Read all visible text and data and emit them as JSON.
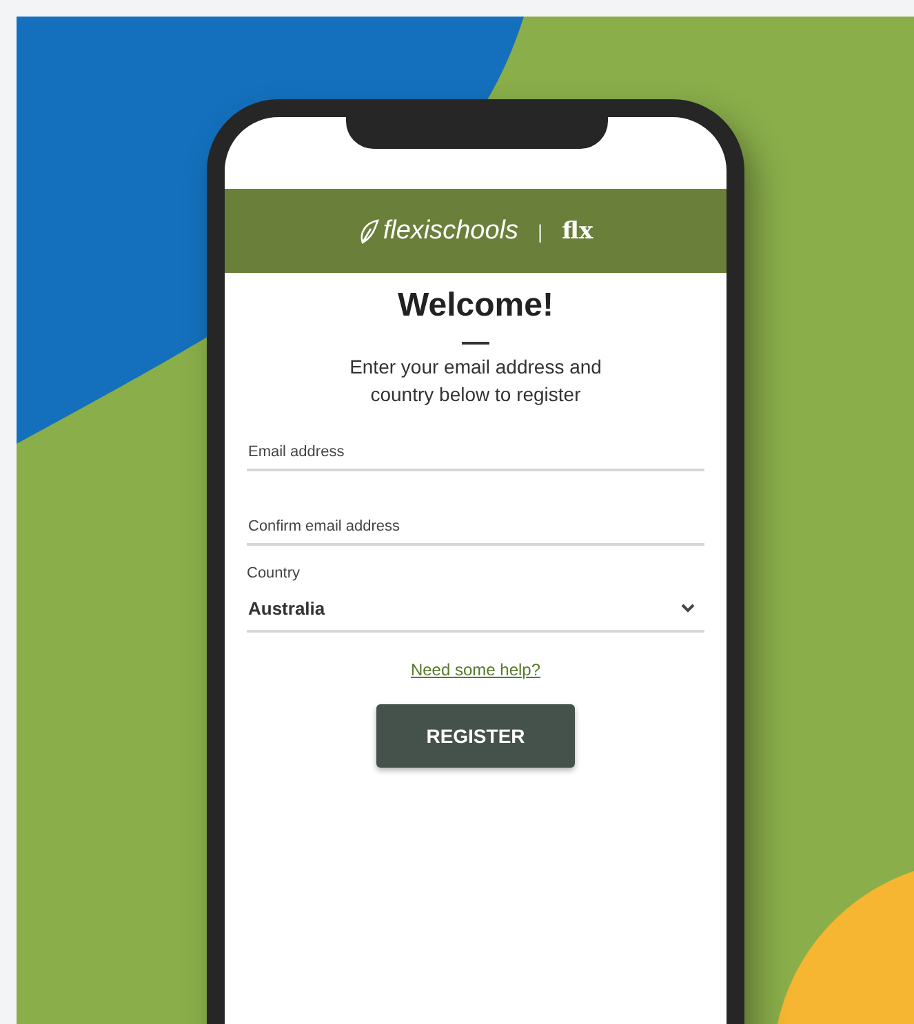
{
  "header": {
    "brand": "flexischools",
    "separator": "|",
    "sub_brand": "flx"
  },
  "title": "Welcome!",
  "subtitle": "Enter your email address and country below to register",
  "fields": [
    {
      "kind": "text",
      "placeholder": "Email address"
    },
    {
      "kind": "text",
      "placeholder": "Confirm email address"
    },
    {
      "kind": "select",
      "label": "Country",
      "value": "Australia"
    }
  ],
  "help_link": "Need some help?",
  "register_button": "REGISTER"
}
